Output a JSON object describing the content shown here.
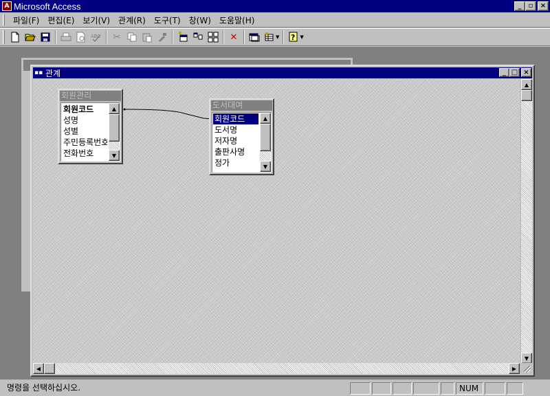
{
  "app": {
    "title": "Microsoft Access",
    "caption_buttons": [
      "_",
      "▫",
      "×"
    ]
  },
  "menu": [
    {
      "label": "파일(F)"
    },
    {
      "label": "편집(E)"
    },
    {
      "label": "보기(V)"
    },
    {
      "label": "관계(R)"
    },
    {
      "label": "도구(T)"
    },
    {
      "label": "창(W)"
    },
    {
      "label": "도움말(H)"
    }
  ],
  "toolbar": {
    "buttons": [
      "new-icon",
      "open-icon",
      "save-icon",
      "print-icon",
      "print-preview-icon",
      "spelling-icon",
      "cut-icon",
      "copy-icon",
      "paste-icon",
      "format-painter-icon",
      "show-table-icon",
      "show-direct-icon",
      "show-all-icon",
      "delete-icon",
      "database-window-icon",
      "new-object-icon",
      "help-icon"
    ]
  },
  "relationships_window": {
    "title": "관계",
    "caption_buttons": [
      "_",
      "□",
      "×"
    ]
  },
  "tables": [
    {
      "name": "회원관리",
      "fields": [
        {
          "label": "회원코드",
          "primary_key": true
        },
        {
          "label": "성명"
        },
        {
          "label": "성별"
        },
        {
          "label": "주민등록번호"
        },
        {
          "label": "전화번호"
        }
      ]
    },
    {
      "name": "도서대여",
      "fields": [
        {
          "label": "회원코드",
          "selected": true
        },
        {
          "label": "도서명"
        },
        {
          "label": "저자명"
        },
        {
          "label": "출판사명"
        },
        {
          "label": "정가"
        }
      ]
    }
  ],
  "status": {
    "message": "명령을 선택하십시오.",
    "num_indicator": "NUM"
  }
}
